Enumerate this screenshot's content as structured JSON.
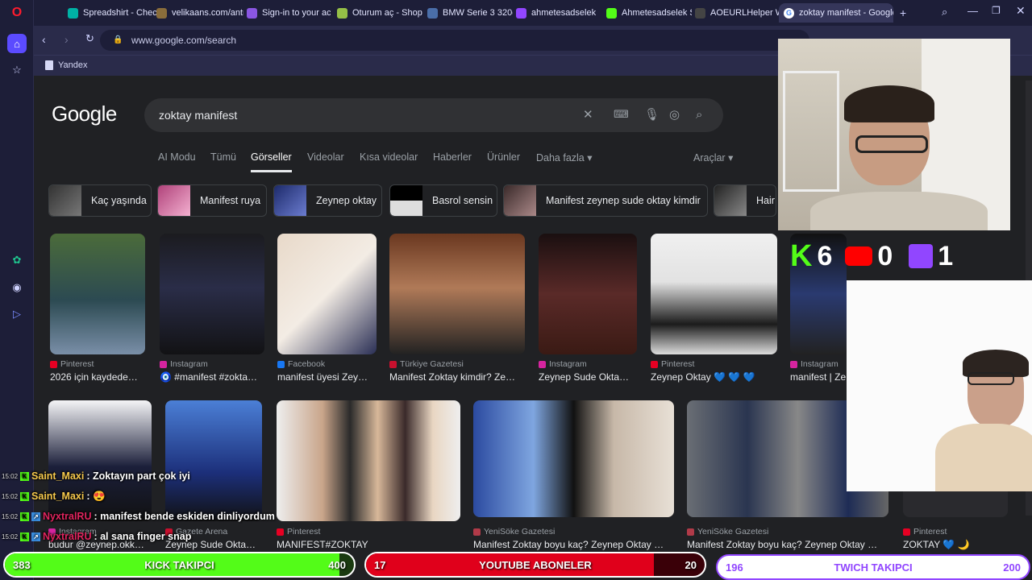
{
  "tabs": [
    {
      "title": "Spreadshirt - Check",
      "color": "#00b2a5",
      "glyph": "S"
    },
    {
      "title": "velikaans.com/antre",
      "color": "#8a6d3b",
      "glyph": "V"
    },
    {
      "title": "Sign-in to your acc",
      "color": "#8a56e2",
      "glyph": "T"
    },
    {
      "title": "Oturum aç - Shopif",
      "color": "#95bf47",
      "glyph": "S"
    },
    {
      "title": "BMW Serie 3 320d",
      "color": "#4a6ea9",
      "glyph": "B"
    },
    {
      "title": "ahmetesadselek - T",
      "color": "#9146ff",
      "glyph": "T"
    },
    {
      "title": "Ahmetesadselek Str",
      "color": "#53fc18",
      "glyph": "K"
    },
    {
      "title": "AOEURLHelper Win",
      "color": "#444444",
      "glyph": "A"
    },
    {
      "title": "zoktay manifest - Google",
      "color": "#ffffff",
      "glyph": "G"
    }
  ],
  "address": {
    "url": "www.google.com/search"
  },
  "bookmarks": {
    "yandex": "Yandex"
  },
  "google": {
    "logo": "Google",
    "query": "zoktay manifest",
    "nav": [
      "AI Modu",
      "Tümü",
      "Görseller",
      "Videolar",
      "Kısa videolar",
      "Haberler",
      "Ürünler",
      "Daha fazla"
    ],
    "tools": "Araçlar",
    "chips": [
      "Kaç yaşında",
      "Manifest ruya",
      "Zeynep oktay",
      "Basrol sensin",
      "Manifest zeynep sude oktay kimdir",
      "Hair m"
    ]
  },
  "results_row1": [
    {
      "source": "Pinterest",
      "caption": "2026 için kaydede…",
      "src_color": "#e60023"
    },
    {
      "source": "Instagram",
      "caption": "🧿 #manifest #zokta…",
      "src_color": "#d6249f"
    },
    {
      "source": "Facebook",
      "caption": "manifest üyesi Zey…",
      "src_color": "#1877f2"
    },
    {
      "source": "Türkiye Gazetesi",
      "caption": "Manifest Zoktay kimdir? Ze…",
      "src_color": "#c8102e"
    },
    {
      "source": "Instagram",
      "caption": "Zeynep Sude Okta…",
      "src_color": "#d6249f"
    },
    {
      "source": "Pinterest",
      "caption": "Zeynep Oktay 💙 💙 💙",
      "src_color": "#e60023"
    },
    {
      "source": "Instagram",
      "caption": "manifest | Ze",
      "src_color": "#d6249f"
    }
  ],
  "results_row2": [
    {
      "source": "Instagram",
      "caption": "budur @zeynep.okk…",
      "src_color": "#d6249f"
    },
    {
      "source": "Gazete Arena",
      "caption": "Zeynep Sude Okta…",
      "src_color": "#c8102e"
    },
    {
      "source": "Pinterest",
      "caption": "MANIFEST#ZOKTAY",
      "src_color": "#e60023"
    },
    {
      "source": "YeniSöke Gazetesi",
      "caption": "Manifest Zoktay boyu kaç? Zeynep Oktay …",
      "src_color": "#b03a48"
    },
    {
      "source": "YeniSöke Gazetesi",
      "caption": "Manifest Zoktay boyu kaç? Zeynep Oktay …",
      "src_color": "#b03a48"
    },
    {
      "source": "Pinterest",
      "caption": "ZOKTAY 💙 🌙",
      "src_color": "#e60023"
    }
  ],
  "stream_counter": {
    "kick": "6",
    "youtube": "0",
    "twitch": "1"
  },
  "chat": [
    {
      "time": "15:02",
      "user": "Saint_Maxi",
      "msg": ": Zoktayın part çok iyi",
      "user_color": "#f5c84c"
    },
    {
      "time": "15:02",
      "user": "Saint_Maxi",
      "msg": ": 😍",
      "user_color": "#f5c84c"
    },
    {
      "time": "15:02",
      "user": "NyxtralRU",
      "msg": ": manifest bende eskiden dinliyordum",
      "user_color": "#e0245e"
    },
    {
      "time": "15:02",
      "user": "NyxtralRU",
      "msg": ": al sana finger snap",
      "user_color": "#e0245e"
    }
  ],
  "goals": [
    {
      "label": "KICK TAKIPCI",
      "current": 383,
      "target": 400,
      "color": "#53fc18",
      "border": "#2a8a10"
    },
    {
      "label": "YOUTUBE ABONELER",
      "current": 17,
      "target": 20,
      "color": "#e0001b",
      "border": "#7a0010"
    },
    {
      "label": "TWICH TAKIPCI",
      "current": 196,
      "target": 200,
      "color": "#9146ff",
      "border": "#5a23b0"
    }
  ]
}
